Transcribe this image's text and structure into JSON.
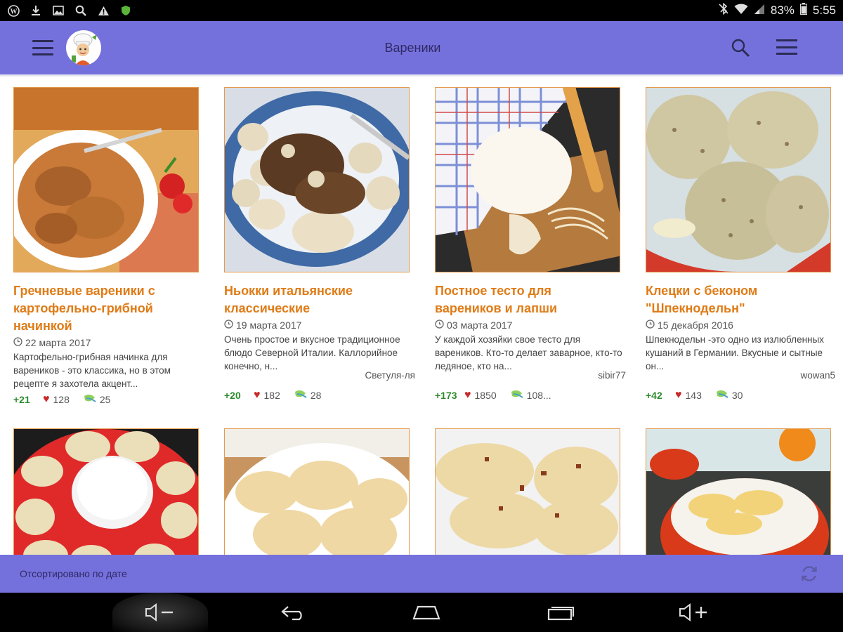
{
  "status_bar": {
    "left_icons": [
      "wordpress-icon",
      "download-icon",
      "image-icon",
      "search-icon",
      "warning-icon",
      "shield-icon"
    ],
    "battery": "83%",
    "time": "5:55"
  },
  "app_bar": {
    "title": "Вареники",
    "menu_icon": "hamburger-icon",
    "search_icon": "search-icon",
    "overflow_icon": "menu-icon",
    "color": "#7571dc"
  },
  "cards": [
    {
      "title": "Гречневые вареники с картофельно-грибной начинкой",
      "date": "22 марта 2017",
      "description": "Картофельно-грибная начинка для вареников - это классика, но в этом рецепте я захотела акцент...",
      "author": "",
      "rating": "+21",
      "likes": "128",
      "comments": "25"
    },
    {
      "title": "Ньокки итальянские классические",
      "date": "19 марта 2017",
      "description": "Очень простое и вкусное традиционное блюдо Северной Италии. Каллорийное конечно, н...",
      "author": "Светуля-ля",
      "rating": "+20",
      "likes": "182",
      "comments": "28"
    },
    {
      "title": "Постное тесто для вареников и лапши",
      "date": "03 марта 2017",
      "description": "У каждой хозяйки свое тесто для вареников. Кто-то делает заварное, кто-то ледяное, кто на...",
      "author": "sibir77",
      "rating": "+173",
      "likes": "1850",
      "comments": "108..."
    },
    {
      "title": "Клецки с беконом \"Шпекнодельн\"",
      "date": "15 декабря 2016",
      "description": "Шпекнодельн -это одно из излюбленных кушаний в Германии. Вкусные и сытные он...",
      "author": "wowan5",
      "rating": "+42",
      "likes": "143",
      "comments": "30"
    }
  ],
  "bottom_bar": {
    "sort_label": "Отсортировано по дате",
    "refresh_icon": "refresh-icon"
  },
  "nav_bar": {
    "buttons": [
      "volume-down-icon",
      "back-icon",
      "home-icon",
      "recents-icon",
      "volume-up-icon"
    ]
  },
  "colors": {
    "accent": "#df7b16",
    "rating_green": "#2e8b2e",
    "heart_red": "#c92929"
  }
}
